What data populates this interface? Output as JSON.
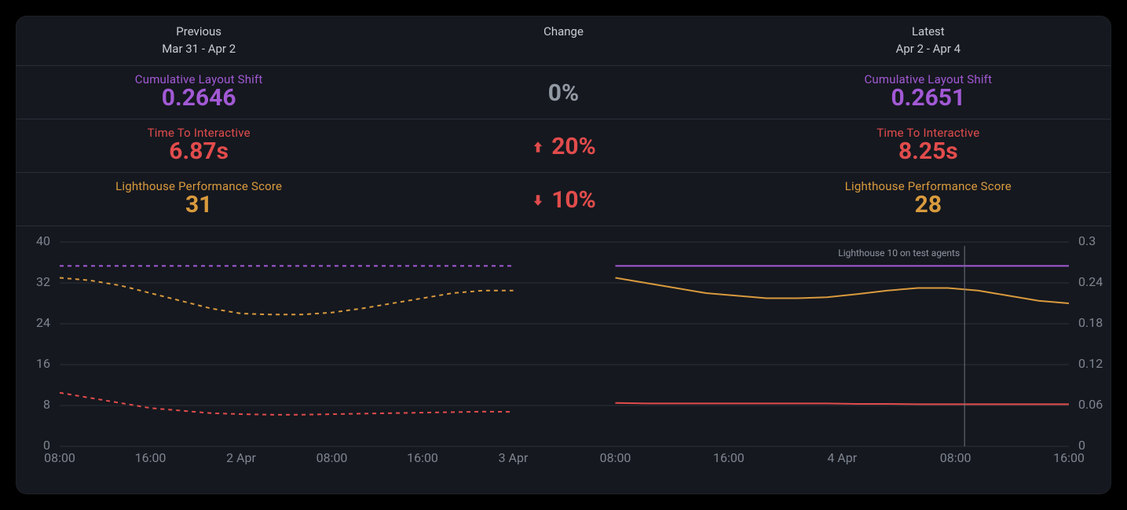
{
  "header": {
    "previous": {
      "title": "Previous",
      "range": "Mar 31 - Apr 2"
    },
    "change": {
      "title": "Change"
    },
    "latest": {
      "title": "Latest",
      "range": "Apr 2 - Apr 4"
    }
  },
  "metrics": {
    "cls": {
      "name": "Cumulative Layout Shift",
      "previous": "0.2646",
      "latest": "0.2651",
      "change": "0%",
      "direction": "none",
      "color": "#A259D5"
    },
    "tti": {
      "name": "Time To Interactive",
      "previous": "6.87s",
      "latest": "8.25s",
      "change": "20%",
      "direction": "up",
      "color": "#E14C4C"
    },
    "lh": {
      "name": "Lighthouse Performance Score",
      "previous": "31",
      "latest": "28",
      "change": "10%",
      "direction": "down",
      "color": "#D99A3D"
    }
  },
  "annotation": "Lighthouse 10 on test agents",
  "chart_styles": {
    "grid": "#2B303A",
    "axis_text": "#7E8590"
  },
  "chart_data": [
    {
      "type": "line",
      "panel": "previous",
      "title": "",
      "xlabel": "",
      "ylabel_left": "Lighthouse Performance Score",
      "ylabel_right": "",
      "style": "dashed",
      "x_ticks": [
        "08:00",
        "16:00",
        "2 Apr",
        "08:00",
        "16:00",
        "3 Apr"
      ],
      "y_left_ticks": [
        0,
        8,
        16,
        24,
        32,
        40
      ],
      "y_left_range": [
        0,
        40
      ],
      "series": [
        {
          "name": "Cumulative Layout Shift",
          "axis": "right",
          "range": [
            0,
            0.3
          ],
          "color": "#A259D5",
          "values": [
            0.265,
            0.265,
            0.265,
            0.265,
            0.265,
            0.265,
            0.265,
            0.265,
            0.265,
            0.265,
            0.265,
            0.265,
            0.265,
            0.265,
            0.265,
            0.265
          ]
        },
        {
          "name": "Lighthouse Performance Score",
          "axis": "left",
          "range": [
            0,
            40
          ],
          "color": "#D99A3D",
          "values": [
            33,
            32.5,
            31.5,
            30,
            28.5,
            27,
            26,
            25.8,
            25.8,
            26.2,
            27,
            28,
            29,
            30,
            30.5,
            30.5
          ]
        },
        {
          "name": "Time To Interactive",
          "axis": "left",
          "range": [
            0,
            40
          ],
          "color": "#E14C4C",
          "values": [
            10.5,
            9.5,
            8.5,
            7.5,
            7,
            6.5,
            6.3,
            6.2,
            6.2,
            6.3,
            6.4,
            6.5,
            6.6,
            6.7,
            6.8,
            6.75
          ]
        }
      ]
    },
    {
      "type": "line",
      "panel": "latest",
      "title": "",
      "xlabel": "",
      "ylabel_left": "",
      "ylabel_right": "Cumulative Layout Shift",
      "style": "solid",
      "x_ticks": [
        "08:00",
        "16:00",
        "4 Apr",
        "08:00",
        "16:00"
      ],
      "y_right_ticks": [
        0,
        0.06,
        0.12,
        0.18,
        0.24,
        0.3
      ],
      "y_right_range": [
        0,
        0.3
      ],
      "annotation": {
        "text": "Lighthouse 10 on test agents",
        "x_frac": 0.77
      },
      "series": [
        {
          "name": "Cumulative Layout Shift",
          "axis": "right",
          "range": [
            0,
            0.3
          ],
          "color": "#A259D5",
          "values": [
            0.265,
            0.265,
            0.265,
            0.265,
            0.265,
            0.265,
            0.265,
            0.265,
            0.265,
            0.265,
            0.265,
            0.265,
            0.265,
            0.265,
            0.265,
            0.265
          ]
        },
        {
          "name": "Lighthouse Performance Score",
          "axis": "left",
          "range": [
            0,
            40
          ],
          "color": "#D99A3D",
          "values": [
            33,
            32,
            31,
            30,
            29.5,
            29,
            29,
            29.2,
            29.8,
            30.5,
            31,
            31,
            30.5,
            29.5,
            28.5,
            28
          ]
        },
        {
          "name": "Time To Interactive",
          "axis": "left",
          "range": [
            0,
            40
          ],
          "color": "#E14C4C",
          "values": [
            8.5,
            8.4,
            8.4,
            8.4,
            8.4,
            8.4,
            8.4,
            8.4,
            8.3,
            8.3,
            8.25,
            8.25,
            8.25,
            8.25,
            8.25,
            8.25
          ]
        }
      ]
    }
  ]
}
